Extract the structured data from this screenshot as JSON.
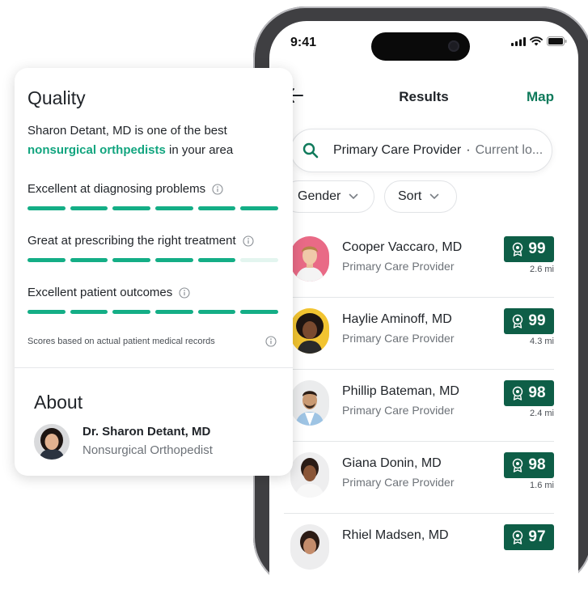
{
  "phone": {
    "status_bar": {
      "time": "9:41"
    },
    "nav": {
      "title": "Results",
      "map_label": "Map"
    },
    "search": {
      "query": "Primary Care Provider",
      "separator": "·",
      "location": "Current lo..."
    },
    "filters": {
      "gender_label": "Gender",
      "sort_label": "Sort"
    },
    "results": [
      {
        "name": "Cooper Vaccaro, MD",
        "specialty": "Primary Care Provider",
        "score": "99",
        "distance": "2.6 mi"
      },
      {
        "name": "Haylie Aminoff, MD",
        "specialty": "Primary Care Provider",
        "score": "99",
        "distance": "4.3 mi"
      },
      {
        "name": "Phillip Bateman, MD",
        "specialty": "Primary Care Provider",
        "score": "98",
        "distance": "2.4 mi"
      },
      {
        "name": "Giana Donin, MD",
        "specialty": "Primary Care Provider",
        "score": "98",
        "distance": "1.6 mi"
      },
      {
        "name": "Rhiel Madsen, MD",
        "specialty": "",
        "score": "97",
        "distance": ""
      }
    ]
  },
  "quality_card": {
    "title": "Quality",
    "description_before": "Sharon Detant, MD is one of the best ",
    "description_highlight": "nonsurgical orthpedists",
    "description_after": " in your area",
    "metrics": [
      {
        "label": "Excellent at diagnosing problems",
        "filled_segments": 6,
        "total_segments": 6
      },
      {
        "label": "Great at prescribing the right treatment",
        "filled_segments": 5,
        "total_segments": 6
      },
      {
        "label": "Excellent patient outcomes",
        "filled_segments": 6,
        "total_segments": 6
      }
    ],
    "footnote": "Scores based on actual patient medical records",
    "about_title": "About",
    "doctor_name": "Dr. Sharon Detant, MD",
    "doctor_specialty": "Nonsurgical Orthopedist"
  },
  "colors": {
    "brand_green": "#0f7a5b",
    "score_badge": "#0e5e47",
    "highlight_text": "#12a57f",
    "bar_filled": "#14ae86",
    "bar_empty": "#e3f5ef"
  },
  "icons": {
    "back": "back-arrow-icon",
    "search": "search-icon",
    "chevron": "chevron-down-icon",
    "award": "award-ribbon-icon",
    "info": "info-icon",
    "signal": "cellular-signal-icon",
    "wifi": "wifi-icon",
    "battery": "battery-icon"
  }
}
